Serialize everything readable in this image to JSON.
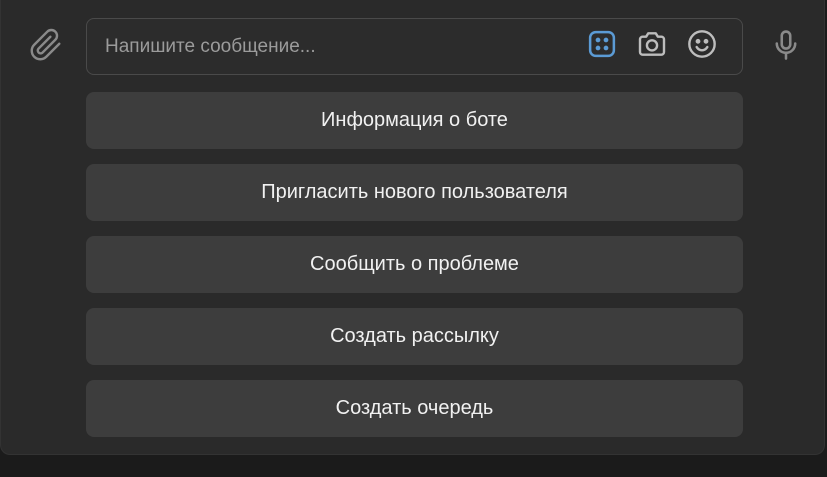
{
  "composer": {
    "placeholder": "Напишите сообщение...",
    "value": "",
    "icons": {
      "attach": "paperclip-icon",
      "bot_commands": "dice-grid-icon",
      "camera": "camera-icon",
      "emoji": "smile-icon",
      "voice": "microphone-icon"
    },
    "accent_color": "#5b9bd5"
  },
  "keyboard": {
    "buttons": [
      {
        "label": "Информация о боте"
      },
      {
        "label": "Пригласить нового пользователя"
      },
      {
        "label": "Сообщить о проблеме"
      },
      {
        "label": "Создать рассылку"
      },
      {
        "label": "Создать очередь"
      }
    ]
  }
}
